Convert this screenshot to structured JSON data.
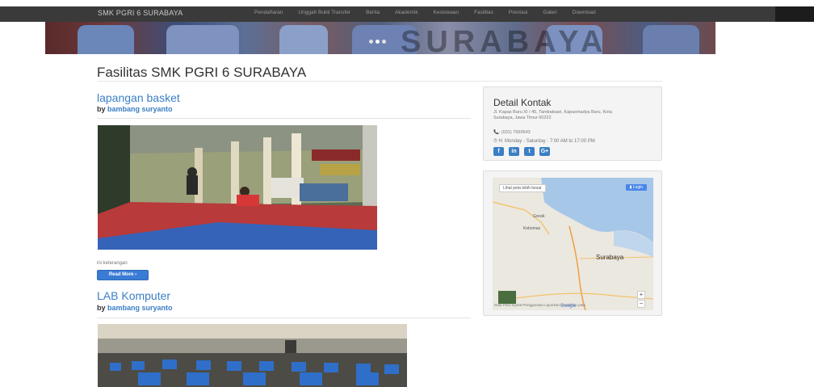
{
  "navbar": {
    "brand": "SMK PGRI 6 SURABAYA",
    "items": [
      "Pendaftaran",
      "Unggah Bukti Transfer",
      "Berita",
      "Akademik",
      "Kesiswaan",
      "Fasilitas",
      "Prestasi",
      "Galeri",
      "Download"
    ]
  },
  "banner": {
    "watermark": "SURABAYA"
  },
  "page": {
    "title": "Fasilitas SMK PGRI 6 SURABAYA"
  },
  "posts": [
    {
      "title": "lapangan basket",
      "by_label": "by",
      "author": "bambang suryanto",
      "excerpt": "ini keterangan",
      "read_more": "Read More ›"
    },
    {
      "title": "LAB Komputer",
      "by_label": "by",
      "author": "bambang suryanto"
    }
  ],
  "contact": {
    "title": "Detail Kontak",
    "address": "Jl. Kapas Baru XI / 45, Tambaksari, Kapasmadya Baru, Kota Surabaya, Jawa Timur 60222",
    "phone": "📞: (031) 7660543",
    "hours": "⏱ H: Monday - Saturday : 7:00 AM to 17:00 PM",
    "socials": [
      "f",
      "in",
      "t",
      "G+"
    ]
  },
  "map": {
    "view_larger": "Lihat peta lebih besar",
    "login": "Login",
    "labels": [
      "Gresik",
      "Kebomas",
      "Surabaya",
      "Google"
    ],
    "footer": "Data Peta   Syarat Penggunaan   Laporkan kesalahan peta"
  },
  "colors": {
    "link": "#3b7fc4",
    "navbar": "#3a3a3a",
    "button": "#3a7bd5"
  }
}
